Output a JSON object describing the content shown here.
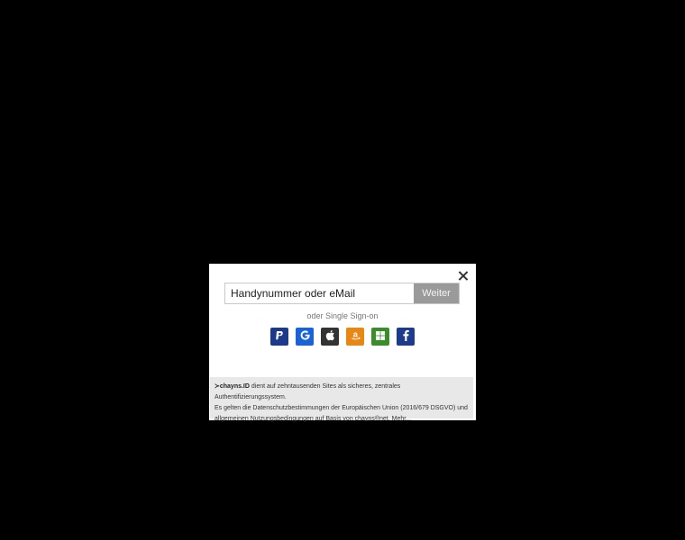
{
  "dialog": {
    "close_label": "×",
    "login": {
      "placeholder": "Handynummer oder eMail",
      "value": "",
      "submit_label": "Weiter"
    },
    "sso_label": "oder Single Sign-on",
    "sso_buttons": [
      {
        "name": "paypal",
        "glyph": "P",
        "color": "#1b3b8a"
      },
      {
        "name": "google",
        "glyph": "G",
        "color": "#1a63d6"
      },
      {
        "name": "apple",
        "glyph": "",
        "color": "#333333"
      },
      {
        "name": "amazon",
        "glyph": "a",
        "color": "#e78815"
      },
      {
        "name": "windows",
        "glyph": "",
        "color": "#3b8c2a"
      },
      {
        "name": "facebook",
        "glyph": "f",
        "color": "#1e3a8a"
      }
    ],
    "footer": {
      "brand": "≻chayns.ID",
      "line1": " dient auf zehntausenden Sites als sicheres, zentrales Authentifizierungssystem.",
      "line2": "Es gelten die Datenschutzbestimmungen der Europäischen Union (2016/679 DSGVO) und",
      "line3": "allgemeinen Nutzungsbedingungen auf Basis von chayns®net.",
      "more_label": "Mehr..."
    }
  }
}
